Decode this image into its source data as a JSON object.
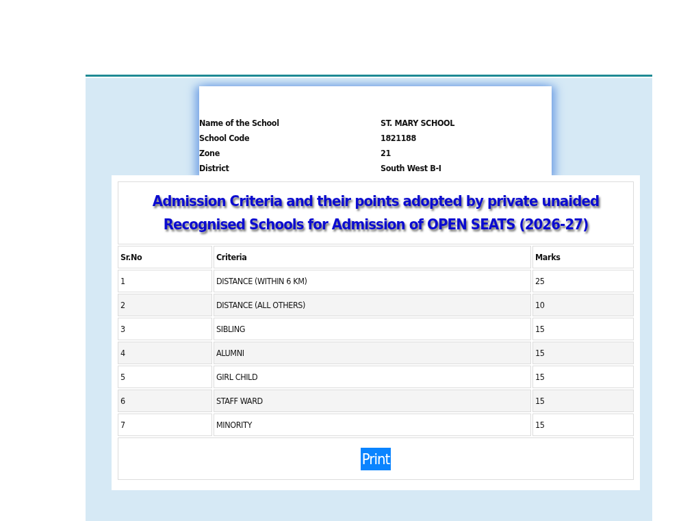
{
  "school_info": [
    {
      "label": "Name of the School",
      "value": "ST. MARY SCHOOL"
    },
    {
      "label": "School Code",
      "value": "1821188"
    },
    {
      "label": "Zone",
      "value": "21"
    },
    {
      "label": "District",
      "value": "South West B-I"
    }
  ],
  "criteria_table": {
    "title": "Admission Criteria and their points adopted by private unaided Recognised  Schools for Admission of OPEN SEATS (2026-27)",
    "columns": [
      "Sr.No",
      "Criteria",
      "Marks"
    ],
    "rows": [
      [
        "1",
        "DISTANCE (WITHIN 6 KM)",
        "25"
      ],
      [
        "2",
        "DISTANCE (ALL OTHERS)",
        "10"
      ],
      [
        "3",
        "SIBLING",
        "15"
      ],
      [
        "4",
        "ALUMNI",
        "15"
      ],
      [
        "5",
        "GIRL CHILD",
        "15"
      ],
      [
        "6",
        "STAFF WARD",
        "15"
      ],
      [
        "7",
        "MINORITY",
        "15"
      ]
    ],
    "print_button": "Print"
  }
}
